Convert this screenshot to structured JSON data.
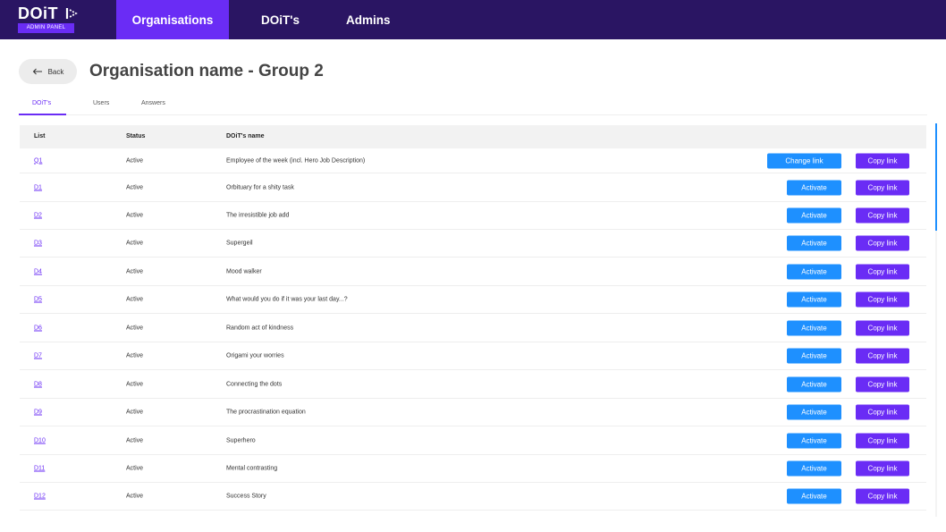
{
  "brand": {
    "name": "DOiT",
    "badge": "ADMIN PANEL"
  },
  "nav": {
    "organisations": "Organisations",
    "doits": "DOiT's",
    "admins": "Admins"
  },
  "header": {
    "back_label": "Back",
    "title": "Organisation name - Group 2"
  },
  "tabs": [
    {
      "label": "DOiT's",
      "active": true
    },
    {
      "label": "Users",
      "active": false
    },
    {
      "label": "Answers",
      "active": false
    }
  ],
  "table": {
    "headers": {
      "list": "List",
      "status": "Status",
      "name": "DOiT's name"
    },
    "rows": [
      {
        "list": "Q1",
        "status": "Active",
        "name": "Employee of the week (incl. Hero Job Description)",
        "action": "Change link",
        "copy": "Copy link"
      },
      {
        "list": "D1",
        "status": "Active",
        "name": "Orbituary for a shity task",
        "action": "Activate",
        "copy": "Copy link"
      },
      {
        "list": "D2",
        "status": "Active",
        "name": "The irresistible job add",
        "action": "Activate",
        "copy": "Copy link"
      },
      {
        "list": "D3",
        "status": "Active",
        "name": "Supergeil",
        "action": "Activate",
        "copy": "Copy link"
      },
      {
        "list": "D4",
        "status": "Active",
        "name": "Mood walker",
        "action": "Activate",
        "copy": "Copy link"
      },
      {
        "list": "D5",
        "status": "Active",
        "name": "What would you do if it was your last day...?",
        "action": "Activate",
        "copy": "Copy link"
      },
      {
        "list": "D6",
        "status": "Active",
        "name": "Random act of kindness",
        "action": "Activate",
        "copy": "Copy link"
      },
      {
        "list": "D7",
        "status": "Active",
        "name": "Origami your worries",
        "action": "Activate",
        "copy": "Copy link"
      },
      {
        "list": "D8",
        "status": "Active",
        "name": "Connecting the dots",
        "action": "Activate",
        "copy": "Copy link"
      },
      {
        "list": "D9",
        "status": "Active",
        "name": "The procrastination equation",
        "action": "Activate",
        "copy": "Copy link"
      },
      {
        "list": "D10",
        "status": "Active",
        "name": "Superhero",
        "action": "Activate",
        "copy": "Copy link"
      },
      {
        "list": "D11",
        "status": "Active",
        "name": "Mental contrasting",
        "action": "Activate",
        "copy": "Copy link"
      },
      {
        "list": "D12",
        "status": "Active",
        "name": "Success Story",
        "action": "Activate",
        "copy": "Copy link"
      }
    ]
  },
  "colors": {
    "nav_bg": "#2a1563",
    "accent_purple": "#6a2cf5",
    "accent_blue": "#1e90ff"
  }
}
